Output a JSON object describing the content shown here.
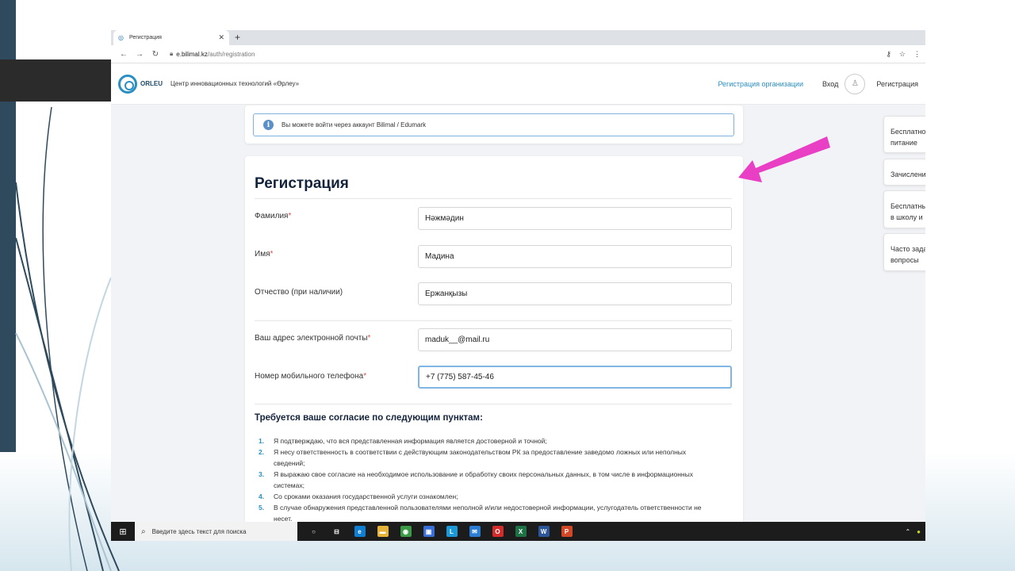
{
  "browser": {
    "tab_title": "Регистрация",
    "tab_close": "✕",
    "new_tab": "+",
    "url_host": "e.bilimal.kz",
    "url_path": "/auth/registration"
  },
  "site": {
    "logo_text": "ORLEU",
    "logo_subtitle": "Центр инновационных технологий «Өрлеу»",
    "org_registration_link": "Регистрация организации",
    "login_link": "Вход",
    "register_link": "Регистрация"
  },
  "info": {
    "icon": "i",
    "message": "Вы можете войти через аккаунт Bilimal / Edumark"
  },
  "form": {
    "title": "Регистрация",
    "fields": [
      {
        "label": "Фамилия",
        "required": "*",
        "value": "Нәжмәдин"
      },
      {
        "label": "Имя",
        "required": "*",
        "value": "Мадина"
      },
      {
        "label": "Отчество (при наличии)",
        "required": "",
        "value": "Ержанқызы"
      },
      {
        "label": "Ваш адрес электронной почты",
        "required": "*",
        "value": "maduk__@mail.ru"
      },
      {
        "label": "Номер мобильного телефона",
        "required": "*",
        "value": "+7 (775) 587-45-46"
      }
    ],
    "consent_title": "Требуется ваше согласие по следующим пунктам:",
    "consent_items": [
      {
        "num": "1.",
        "text": "Я подтверждаю, что вся представленная информация является достоверной и точной;"
      },
      {
        "num": "2.",
        "text": "Я несу ответственность в соответствии с действующим законодательством РК за предоставление заведомо ложных или неполных сведений;"
      },
      {
        "num": "3.",
        "text": "Я выражаю свое согласие на необходимое использование и обработку своих персональных данных, в том числе в информационных системах;"
      },
      {
        "num": "4.",
        "text": "Со сроками оказания государственной услуги ознакомлен;"
      },
      {
        "num": "5.",
        "text": "В случае обнаружения представленной пользователями неполной и/или недостоверной информации, услугодатель ответственности не несет."
      }
    ]
  },
  "sidebar": {
    "items": [
      {
        "label": "Бесплатно питание"
      },
      {
        "label": "Зачислени"
      },
      {
        "label": "Бесплатны в школу и"
      },
      {
        "label": "Часто зада вопросы"
      }
    ]
  },
  "taskbar": {
    "search_placeholder": "Введите здесь текст для поиска",
    "apps": [
      {
        "icon": "cortana-icon",
        "glyph": "○",
        "color": "#1c1c1c"
      },
      {
        "icon": "task-view-icon",
        "glyph": "⊟",
        "color": "#1c1c1c"
      },
      {
        "icon": "edge-icon",
        "glyph": "e",
        "color": "#0f7fd4"
      },
      {
        "icon": "file-explorer-icon",
        "glyph": "▬",
        "color": "#e6b33a"
      },
      {
        "icon": "chrome-icon",
        "glyph": "◉",
        "color": "#3a9a46"
      },
      {
        "icon": "store-icon",
        "glyph": "▣",
        "color": "#3a6fd8"
      },
      {
        "icon": "l-app-icon",
        "glyph": "L",
        "color": "#1a9ad8"
      },
      {
        "icon": "mail-icon",
        "glyph": "✉",
        "color": "#2b7cd3"
      },
      {
        "icon": "opera-icon",
        "glyph": "O",
        "color": "#d42b2b"
      },
      {
        "icon": "excel-icon",
        "glyph": "X",
        "color": "#1e7145"
      },
      {
        "icon": "word-icon",
        "glyph": "W",
        "color": "#2b579a"
      },
      {
        "icon": "powerpoint-icon",
        "glyph": "P",
        "color": "#d24726"
      }
    ]
  },
  "colors": {
    "accent": "#2a8fc1",
    "arrow": "#e83fc4",
    "slide_band": "#2e4a5c"
  }
}
